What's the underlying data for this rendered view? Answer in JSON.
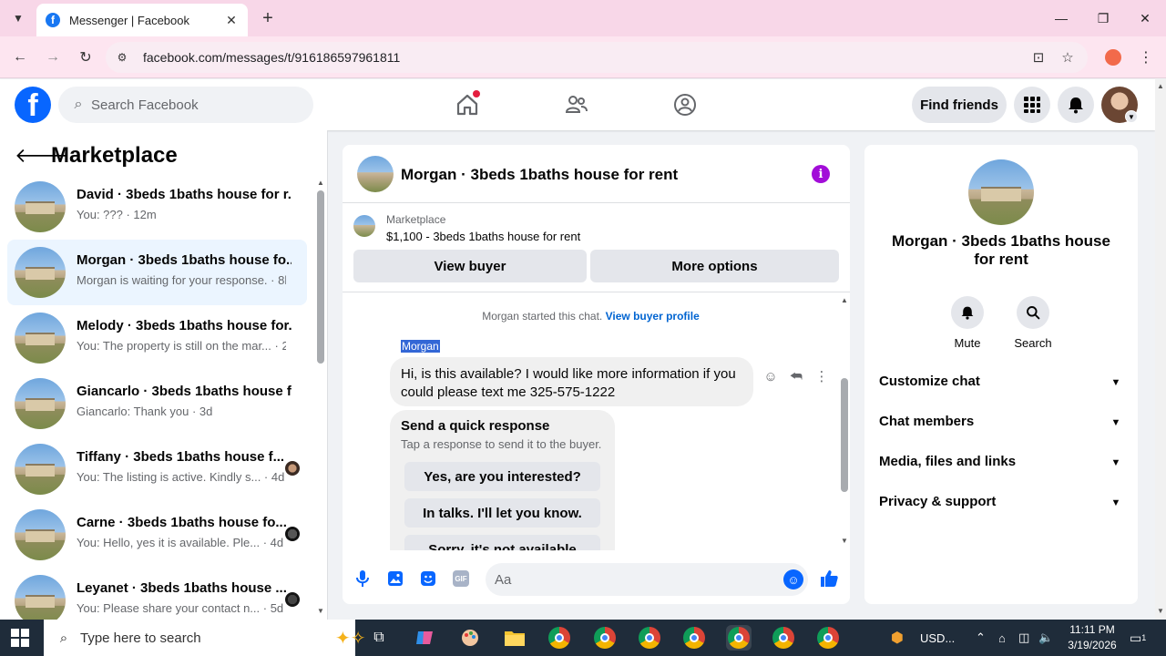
{
  "browser": {
    "tab_title": "Messenger | Facebook",
    "url": "facebook.com/messages/t/916186597961811"
  },
  "fb": {
    "search_placeholder": "Search Facebook",
    "find_friends": "Find friends"
  },
  "sidebar": {
    "title": "Marketplace",
    "conversations": [
      {
        "name": "David · 3beds 1baths house for r...",
        "preview": "You: ??? · 12m"
      },
      {
        "name": "Morgan · 3beds 1baths house fo...",
        "preview": "Morgan is waiting for your response. · 8h"
      },
      {
        "name": "Melody · 3beds 1baths house for...",
        "preview": "You: The property is still on the mar... · 2d"
      },
      {
        "name": "Giancarlo · 3beds 1baths house f...",
        "preview": "Giancarlo: Thank you · 3d"
      },
      {
        "name": "Tiffany · 3beds 1baths house f...",
        "preview": "You: The listing is active. Kindly s... · 4d"
      },
      {
        "name": "Carne · 3beds 1baths house fo...",
        "preview": "You: Hello, yes it is available. Ple... · 4d"
      },
      {
        "name": "Leyanet · 3beds 1baths house ...",
        "preview": "You: Please share your contact n... · 5d"
      }
    ]
  },
  "chat": {
    "title": "Morgan · 3beds 1baths house for rent",
    "listing_label": "Marketplace",
    "listing_price": "$1,100 - 3beds 1baths house for rent",
    "view_buyer": "View buyer",
    "more_options": "More options",
    "started_text": "Morgan started this chat.",
    "view_buyer_profile": "View buyer profile",
    "sender": "Morgan",
    "message_line1": "Hi, is this available? I would like more information if you",
    "message_line2": "could please text me 325-575-1222",
    "quick_title": "Send a quick response",
    "quick_sub": "Tap a response to send it to the buyer.",
    "quick_options": [
      "Yes, are you interested?",
      "In talks. I'll let you know.",
      "Sorry, it's not available"
    ],
    "composer_placeholder": "Aa",
    "gif_label": "GIF"
  },
  "right_panel": {
    "name": "Morgan · 3beds 1baths house for rent",
    "mute": "Mute",
    "search": "Search",
    "sections": [
      "Customize chat",
      "Chat members",
      "Media, files and links",
      "Privacy & support"
    ]
  },
  "taskbar": {
    "search_placeholder": "Type here to search",
    "currency": "USD...",
    "time": "11:11 PM",
    "date": "3/19/2026",
    "notif_count": "1"
  }
}
